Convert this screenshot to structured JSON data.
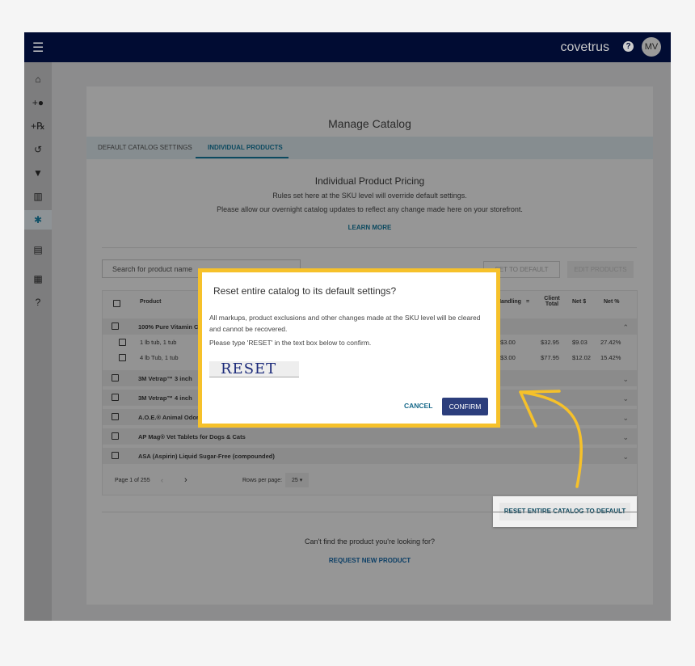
{
  "header": {
    "brand": "covetrus",
    "avatar": "MV",
    "menu_icon": "hamburger-icon",
    "help_icon": "question-icon"
  },
  "sidebar": {
    "items": [
      {
        "icon": "home-icon",
        "glyph": "⌂"
      },
      {
        "icon": "add-user-icon",
        "glyph": "+●"
      },
      {
        "icon": "add-rx-icon",
        "glyph": "+℞"
      },
      {
        "icon": "history-icon",
        "glyph": "↺"
      },
      {
        "icon": "basket-icon",
        "glyph": "▼"
      },
      {
        "icon": "chart-icon",
        "glyph": "▥"
      },
      {
        "icon": "settings-icon",
        "glyph": "✱"
      },
      {
        "icon": "store-icon",
        "glyph": "▤"
      },
      {
        "icon": "layout-icon",
        "glyph": "▦"
      },
      {
        "icon": "help-icon",
        "glyph": "?"
      }
    ]
  },
  "page": {
    "title": "Manage Catalog",
    "tabs": [
      "DEFAULT CATALOG SETTINGS",
      "INDIVIDUAL PRODUCTS"
    ],
    "active_tab": 1,
    "section_title": "Individual Product Pricing",
    "line1": "Rules set here at the SKU level will override default settings.",
    "line2": "Please allow our overnight catalog updates to reflect any change made here on your storefront.",
    "learn_more": "LEARN MORE",
    "search_placeholder": "Search for product name",
    "reset_btn_partial": "SET TO DEFAULT",
    "edit_btn": "EDIT PRODUCTS",
    "columns": {
      "product": "Product",
      "handling": "Handling",
      "eq": "=",
      "client_total": "Client Total",
      "net_dollar": "Net $",
      "net_pct": "Net %"
    },
    "products": [
      {
        "name": "100% Pure Vitamin C",
        "expanded": true,
        "skus": [
          {
            "name": "1 lb tub, 1 tub",
            "handling": "$3.00",
            "client_total": "$32.95",
            "net": "$9.03",
            "net_pct": "27.42%"
          },
          {
            "name": "4 lb Tub, 1 tub",
            "handling": "$3.00",
            "client_total": "$77.95",
            "net": "$12.02",
            "net_pct": "15.42%"
          }
        ]
      },
      {
        "name": "3M Vetrap™ 3 inch"
      },
      {
        "name": "3M Vetrap™ 4 inch"
      },
      {
        "name": "A.O.E.® Animal Odor"
      },
      {
        "name": "AP Mag® Vet Tablets for Dogs & Cats"
      },
      {
        "name": "ASA (Aspirin) Liquid Sugar-Free (compounded)"
      }
    ],
    "pagination": {
      "page": "Page 1 of 255",
      "rows_label": "Rows per page:",
      "rows_value": "25"
    },
    "reset_catalog": "RESET ENTIRE CATALOG TO DEFAULT",
    "cant_find": "Can't find the product you're looking for?",
    "request": "REQUEST NEW PRODUCT"
  },
  "modal": {
    "title": "Reset entire catalog to its default settings?",
    "body1": "All markups, product exclusions and other changes made at the SKU level will be cleared and cannot be recovered.",
    "body2": "Please type 'RESET' in the text box below to confirm.",
    "input_value": "RESET",
    "cancel": "CANCEL",
    "confirm": "CONFIRM"
  },
  "colors": {
    "header": "#010c33",
    "accent": "#0c4a60",
    "confirm": "#2c3e7c",
    "highlight": "#f6c12a"
  }
}
